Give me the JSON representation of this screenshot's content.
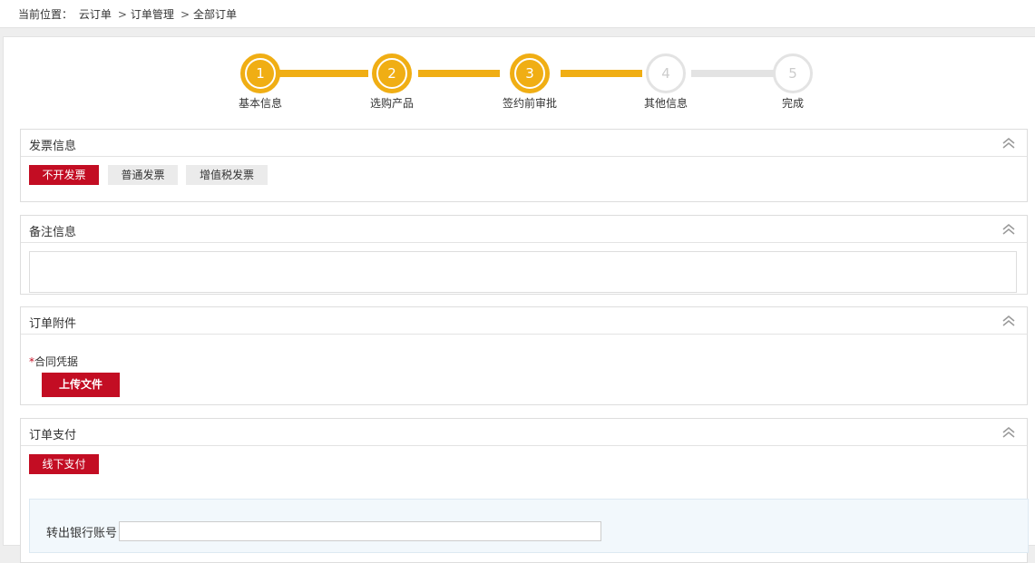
{
  "breadcrumb": {
    "prefix": "当前位置：",
    "items": [
      "云订单",
      "订单管理",
      "全部订单"
    ],
    "separator": ">"
  },
  "stepper": {
    "steps": [
      {
        "number": "1",
        "label": "基本信息",
        "state": "done"
      },
      {
        "number": "2",
        "label": "选购产品",
        "state": "done"
      },
      {
        "number": "3",
        "label": "签约前审批",
        "state": "done"
      },
      {
        "number": "4",
        "label": "其他信息",
        "state": "todo"
      },
      {
        "number": "5",
        "label": "完成",
        "state": "todo"
      }
    ],
    "active_color": "#f0ae14",
    "inactive_color": "#e3e3e3"
  },
  "invoice": {
    "title": "发票信息",
    "options": [
      {
        "label": "不开发票",
        "selected": true
      },
      {
        "label": "普通发票",
        "selected": false
      },
      {
        "label": "增值税发票",
        "selected": false
      }
    ]
  },
  "remarks": {
    "title": "备注信息",
    "value": ""
  },
  "attachments": {
    "title": "订单附件",
    "required_mark": "*",
    "field_label": "合同凭据",
    "upload_label": "上传文件"
  },
  "payment": {
    "title": "订单支付",
    "method_label": "线下支付",
    "account_label": "转出银行账号",
    "account_value": ""
  },
  "colors": {
    "primary_red": "#c30d23",
    "step_orange": "#f0ae14"
  }
}
